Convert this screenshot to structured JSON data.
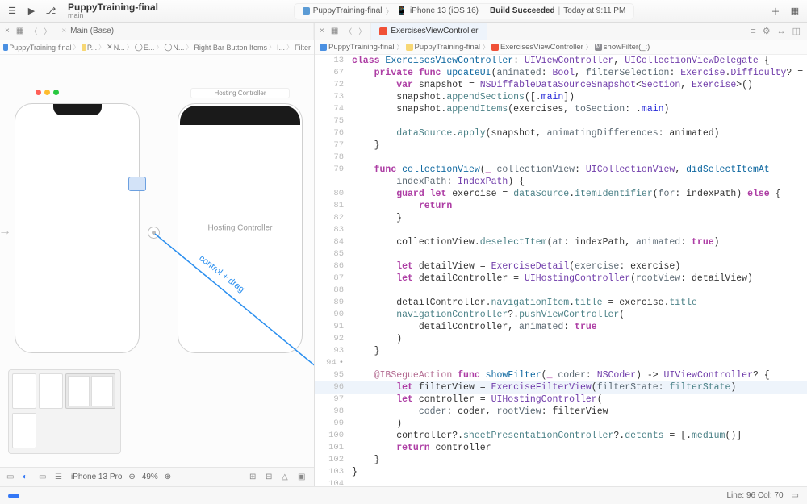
{
  "toolbar": {
    "project_name": "PuppyTraining-final",
    "branch": "main",
    "scheme": "PuppyTraining-final",
    "device": "iPhone 13 (iOS 16)",
    "build_status": "Build Succeeded",
    "build_time": "Today at 9:11 PM"
  },
  "left_tabs": {
    "main_tab": "Main (Base)"
  },
  "ib_jump": {
    "p0": "PuppyTraining-final",
    "p1": "P...",
    "p2": "N...",
    "p3": "E...",
    "p4": "N...",
    "p5": "Right Bar Button Items",
    "p6": "I...",
    "p7": "Filter"
  },
  "ib": {
    "phone1_window": "• • •",
    "phone2_title": "Hosting Controller",
    "hosting_label": "Hosting Controller",
    "arrow_label": "control + drag",
    "device_label": "iPhone 13 Pro",
    "zoom": "49%"
  },
  "editor": {
    "tab_file": "ExercisesViewController",
    "jump": {
      "p0": "PuppyTraining-final",
      "p1": "PuppyTraining-final",
      "p2": "ExercisesViewController",
      "p3": "showFilter(_:)"
    }
  },
  "code_lines": [
    {
      "n": 13,
      "t": "<kw>class</kw> <decl>ExercisesViewController</decl>: <type>UIViewController</type>, <type>UICollectionViewDelegate</type> {"
    },
    {
      "n": 67,
      "t": "    <kw>private</kw> <kw>func</kw> <decl>updateUI</decl>(<param>animated</param>: <type>Bool</type>, <param>filterSelection</param>: <type>Exercise</type>.<type>Difficulty</type>? = …"
    },
    {
      "n": 72,
      "t": "        <kw>var</kw> snapshot = <type>NSDiffableDataSourceSnapshot</type>&lt;<type>Section</type>, <type>Exercise</type>&gt;()"
    },
    {
      "n": 73,
      "t": "        snapshot.<func>appendSections</func>([.<lit>main</lit>])"
    },
    {
      "n": 74,
      "t": "        snapshot.<func>appendItems</func>(exercises, <param>toSection</param>: .<lit>main</lit>)"
    },
    {
      "n": 75,
      "t": ""
    },
    {
      "n": 76,
      "t": "        <type2>dataSource</type2>.<func>apply</func>(snapshot, <param>animatingDifferences</param>: animated)"
    },
    {
      "n": 77,
      "t": "    }"
    },
    {
      "n": 78,
      "t": ""
    },
    {
      "n": 79,
      "t": "    <kw>func</kw> <decl>collectionView</decl>(<kw>_</kw> <param>collectionView</param>: <type>UICollectionView</type>, <decl>didSelectItemAt</decl>"
    },
    {
      "n": "",
      "t": "        <param>indexPath</param>: <type>IndexPath</type>) {"
    },
    {
      "n": 80,
      "t": "        <kw>guard</kw> <kw>let</kw> exercise = <type2>dataSource</type2>.<func>itemIdentifier</func>(<param>for</param>: indexPath) <kw>else</kw> {"
    },
    {
      "n": 81,
      "t": "            <kw>return</kw>"
    },
    {
      "n": 82,
      "t": "        }"
    },
    {
      "n": 83,
      "t": ""
    },
    {
      "n": 84,
      "t": "        collectionView.<func>deselectItem</func>(<param>at</param>: indexPath, <param>animated</param>: <kw>true</kw>)"
    },
    {
      "n": 85,
      "t": ""
    },
    {
      "n": 86,
      "t": "        <kw>let</kw> detailView = <type>ExerciseDetail</type>(<param>exercise</param>: exercise)"
    },
    {
      "n": 87,
      "t": "        <kw>let</kw> detailController = <type>UIHostingController</type>(<param>rootView</param>: detailView)"
    },
    {
      "n": 88,
      "t": ""
    },
    {
      "n": 89,
      "t": "        detailController.<type2>navigationItem</type2>.<type2>title</type2> = exercise.<type2>title</type2>"
    },
    {
      "n": 90,
      "t": "        <type2>navigationController</type2>?.<func>pushViewController</func>("
    },
    {
      "n": 91,
      "t": "            detailController, <param>animated</param>: <kw>true</kw>"
    },
    {
      "n": 92,
      "t": "        )"
    },
    {
      "n": 93,
      "t": "    }"
    },
    {
      "n": 94,
      "t": "",
      "dot": true
    },
    {
      "n": 95,
      "t": "    <attr>@IBSegueAction</attr> <kw>func</kw> <decl>showFilter</decl>(<kw>_</kw> <param>coder</param>: <type>NSCoder</type>) -> <type>UIViewController</type>? {"
    },
    {
      "n": 96,
      "t": "        <kw>let</kw> filterView = <type>ExerciseFilterView</type>(<param>filterState</param>: <type2>filterState</type2>)",
      "hl": true
    },
    {
      "n": 97,
      "t": "        <kw>let</kw> controller = <type>UIHostingController</type>("
    },
    {
      "n": 98,
      "t": "            <param>coder</param>: coder, <param>rootView</param>: filterView"
    },
    {
      "n": 99,
      "t": "        )"
    },
    {
      "n": 100,
      "t": "        controller?.<type2>sheetPresentationController</type2>?.<type2>detents</type2> = [.<func>medium</func>()]"
    },
    {
      "n": 101,
      "t": "        <kw>return</kw> controller"
    },
    {
      "n": 102,
      "t": "    }"
    },
    {
      "n": 103,
      "t": "}"
    },
    {
      "n": 104,
      "t": ""
    }
  ],
  "footer": {
    "cursor": "Line: 96  Col: 70"
  }
}
